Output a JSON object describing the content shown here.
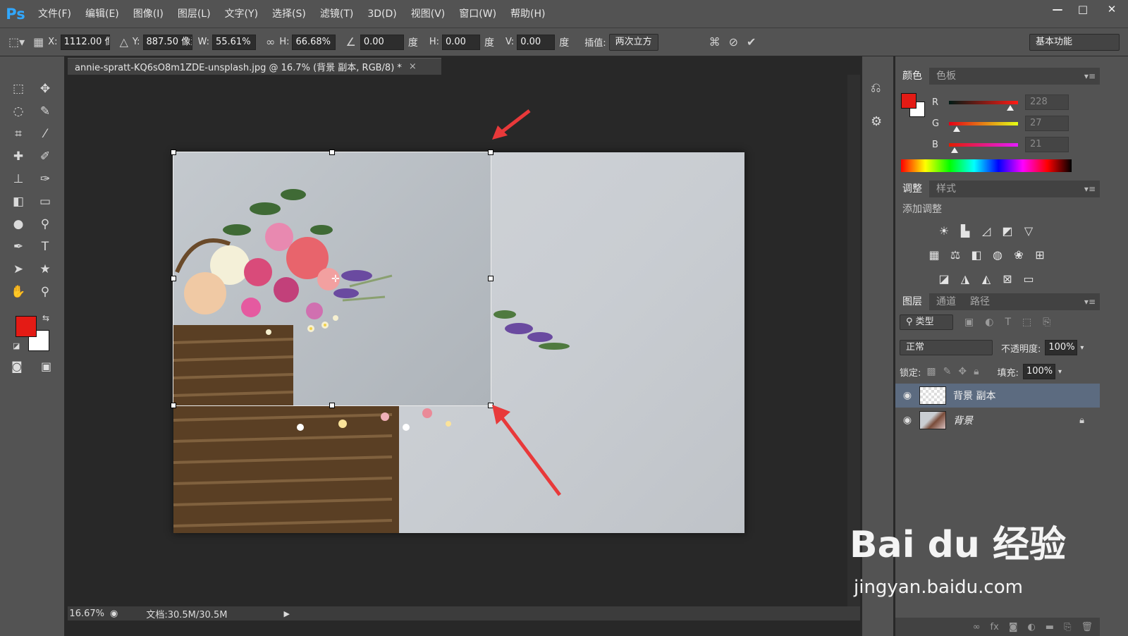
{
  "app": {
    "logo": "Ps"
  },
  "menu": [
    "文件(F)",
    "编辑(E)",
    "图像(I)",
    "图层(L)",
    "文字(Y)",
    "选择(S)",
    "滤镜(T)",
    "3D(D)",
    "视图(V)",
    "窗口(W)",
    "帮助(H)"
  ],
  "window_controls": {
    "minimize": "—",
    "maximize": "□",
    "close": "✕"
  },
  "options": {
    "x_label": "X:",
    "x_value": "1112.00 像",
    "y_label": "Y:",
    "y_value": "887.50 像素",
    "w_label": "W:",
    "w_value": "55.61%",
    "h_label": "H:",
    "h_value": "66.68%",
    "angle_value": "0.00",
    "angle_unit": "度",
    "hskew_label": "H:",
    "hskew_value": "0.00",
    "hskew_unit": "度",
    "vskew_label": "V:",
    "vskew_value": "0.00",
    "vskew_unit": "度",
    "interp_label": "插值:",
    "interp_value": "两次立方",
    "workspace": "基本功能"
  },
  "document": {
    "tab_title": "annie-spratt-KQ6sO8m1ZDE-unsplash.jpg @ 16.7% (背景 副本, RGB/8) *",
    "tab_close": "×"
  },
  "status": {
    "zoom": "16.67%",
    "doc_info": "文档:30.5M/30.5M"
  },
  "color_panel": {
    "tabs": [
      "颜色",
      "色板"
    ],
    "r_label": "R",
    "r_value": "228",
    "r_fraction": 0.89,
    "g_label": "G",
    "g_value": "27",
    "g_fraction": 0.11,
    "b_label": "B",
    "b_value": "21",
    "b_fraction": 0.08
  },
  "adjust_panel": {
    "tabs": [
      "调整",
      "样式"
    ],
    "title": "添加调整"
  },
  "layers_panel": {
    "tabs": [
      "图层",
      "通道",
      "路径"
    ],
    "filter": "类型",
    "blend_mode": "正常",
    "opacity_label": "不透明度:",
    "opacity_value": "100%",
    "lock_label": "锁定:",
    "fill_label": "填充:",
    "fill_value": "100%",
    "layers": [
      {
        "name": "背景 副本",
        "selected": true
      },
      {
        "name": "背景",
        "locked": true
      }
    ]
  },
  "watermark": {
    "logo": "Bai du 经验",
    "url": "jingyan.baidu.com"
  },
  "colors": {
    "foreground": "#e41b15",
    "background": "#ffffff",
    "selection": "#5c6b80",
    "arrow": "#e8393a"
  }
}
